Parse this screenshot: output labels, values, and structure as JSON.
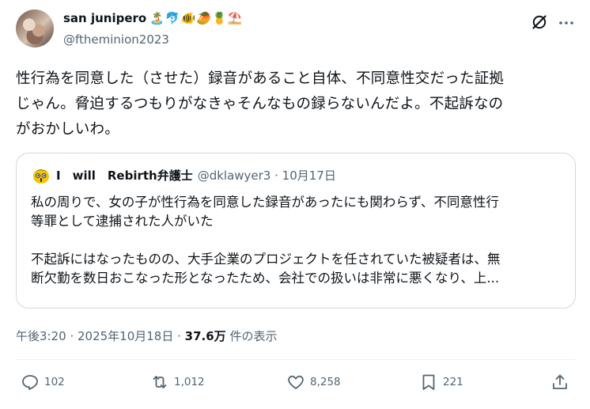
{
  "author": {
    "display_name": "san junipero",
    "emojis": [
      "🏝️",
      "🐬",
      "🐠",
      "🥭",
      "🍍",
      "⛱️"
    ],
    "handle": "@ftheminion2023"
  },
  "tweet": {
    "lines": [
      "性行為を同意した（させた）録音があること自体、不同意性交だった証拠",
      "じゃん。脅迫するつもりがなきゃそんなもの録らないんだよ。不起訴なの",
      "がおかしいわ。"
    ]
  },
  "quote": {
    "name": "I　will　Rebirth弁護士",
    "handle": "@dklawyer3 · 10月17日",
    "paragraph1": [
      "私の周りで、女の子が性行為を同意した録音があったにも関わらず、不同意性行",
      "等罪として逮捕された人がいた"
    ],
    "paragraph2": [
      "不起訴にはなったものの、大手企業のプロジェクトを任されていた被疑者は、無",
      "断欠勤を数日おこなった形となったため、会社での扱いは非常に悪くなり、上..."
    ]
  },
  "meta": {
    "timestamp": "午後3:20 · 2025年10月18日 · ",
    "views_count": "37.6万",
    "views_label": " 件の表示"
  },
  "actions": {
    "replies": "102",
    "retweets": "1,012",
    "likes": "8,258",
    "bookmarks": "221"
  },
  "colors": {
    "text": "#0f1419",
    "secondary": "#536471",
    "border": "#cfd9de"
  }
}
